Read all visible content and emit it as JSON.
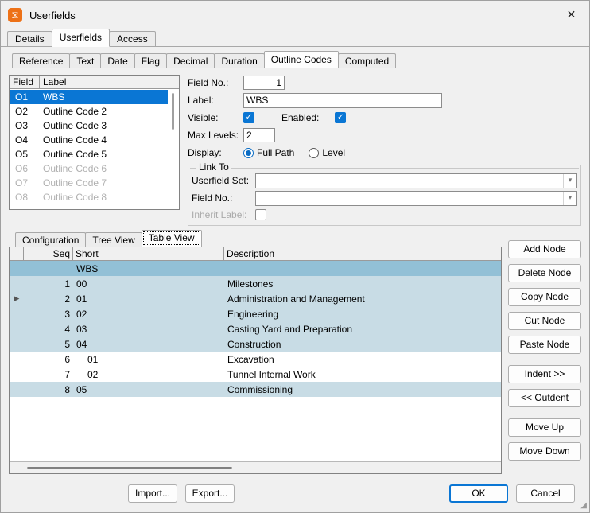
{
  "window": {
    "title": "Userfields",
    "icon": "app-spiral-icon",
    "close_label": "✕"
  },
  "outer_tabs": [
    {
      "label": "Details",
      "active": false
    },
    {
      "label": "Userfields",
      "active": true
    },
    {
      "label": "Access",
      "active": false
    }
  ],
  "inner_tabs": [
    {
      "label": "Reference",
      "active": false
    },
    {
      "label": "Text",
      "active": false
    },
    {
      "label": "Date",
      "active": false
    },
    {
      "label": "Flag",
      "active": false
    },
    {
      "label": "Decimal",
      "active": false
    },
    {
      "label": "Duration",
      "active": false
    },
    {
      "label": "Outline Codes",
      "active": true
    },
    {
      "label": "Computed",
      "active": false
    }
  ],
  "field_list": {
    "headers": {
      "field": "Field",
      "label": "Label"
    },
    "rows": [
      {
        "field": "O1",
        "label": "WBS",
        "selected": true,
        "disabled": false
      },
      {
        "field": "O2",
        "label": "Outline Code 2",
        "selected": false,
        "disabled": false
      },
      {
        "field": "O3",
        "label": "Outline Code 3",
        "selected": false,
        "disabled": false
      },
      {
        "field": "O4",
        "label": "Outline Code 4",
        "selected": false,
        "disabled": false
      },
      {
        "field": "O5",
        "label": "Outline Code 5",
        "selected": false,
        "disabled": false
      },
      {
        "field": "O6",
        "label": "Outline Code 6",
        "selected": false,
        "disabled": true
      },
      {
        "field": "O7",
        "label": "Outline Code 7",
        "selected": false,
        "disabled": true
      },
      {
        "field": "O8",
        "label": "Outline Code 8",
        "selected": false,
        "disabled": true
      }
    ]
  },
  "form": {
    "field_no_label": "Field No.:",
    "field_no_value": "1",
    "label_label": "Label:",
    "label_value": "WBS",
    "visible_label": "Visible:",
    "visible_checked": true,
    "enabled_label": "Enabled:",
    "enabled_checked": true,
    "max_levels_label": "Max Levels:",
    "max_levels_value": "2",
    "display_label": "Display:",
    "display_options": [
      {
        "label": "Full Path",
        "selected": true
      },
      {
        "label": "Level",
        "selected": false
      }
    ],
    "link_to": {
      "legend": "Link To",
      "userfield_set_label": "Userfield Set:",
      "userfield_set_value": "",
      "field_no_label": "Field No.:",
      "field_no_value": "",
      "inherit_label_label": "Inherit Label:",
      "inherit_label_checked": false,
      "inherit_label_disabled": true
    }
  },
  "view_tabs": [
    {
      "label": "Configuration",
      "active": false
    },
    {
      "label": "Tree View",
      "active": false
    },
    {
      "label": "Table View",
      "active": true
    }
  ],
  "grid": {
    "headers": {
      "mark": "",
      "seq": "Seq",
      "short": "Short",
      "description": "Description"
    },
    "rows": [
      {
        "mark": "",
        "seq": "",
        "short": "WBS",
        "description": "",
        "highlight": "strong",
        "indent": 0
      },
      {
        "mark": "",
        "seq": "1",
        "short": "00",
        "description": "Milestones",
        "highlight": "light",
        "indent": 0
      },
      {
        "mark": "▶",
        "seq": "2",
        "short": "01",
        "description": "Administration and Management",
        "highlight": "light",
        "indent": 0
      },
      {
        "mark": "",
        "seq": "3",
        "short": "02",
        "description": "Engineering",
        "highlight": "light",
        "indent": 0
      },
      {
        "mark": "",
        "seq": "4",
        "short": "03",
        "description": "Casting Yard and Preparation",
        "highlight": "light",
        "indent": 0
      },
      {
        "mark": "",
        "seq": "5",
        "short": "04",
        "description": "Construction",
        "highlight": "light",
        "indent": 0
      },
      {
        "mark": "",
        "seq": "6",
        "short": "01",
        "description": "Excavation",
        "highlight": "none",
        "indent": 1
      },
      {
        "mark": "",
        "seq": "7",
        "short": "02",
        "description": "Tunnel Internal Work",
        "highlight": "none",
        "indent": 1
      },
      {
        "mark": "",
        "seq": "8",
        "short": "05",
        "description": "Commissioning",
        "highlight": "light",
        "indent": 0
      }
    ]
  },
  "node_buttons": [
    {
      "label": "Add Node",
      "gap": false
    },
    {
      "label": "Delete Node",
      "gap": false
    },
    {
      "label": "Copy Node",
      "gap": false
    },
    {
      "label": "Cut Node",
      "gap": false
    },
    {
      "label": "Paste Node",
      "gap": false
    },
    {
      "label": "Indent >>",
      "gap": true
    },
    {
      "label": "<< Outdent",
      "gap": false
    },
    {
      "label": "Move Up",
      "gap": true
    },
    {
      "label": "Move Down",
      "gap": false
    }
  ],
  "footer": {
    "import_label": "Import...",
    "export_label": "Export...",
    "ok_label": "OK",
    "cancel_label": "Cancel"
  },
  "colors": {
    "accent": "#0a76d4",
    "selection": "#0a76d4",
    "row_highlight": "#c8dce5",
    "row_highlight_strong": "#92c0d6",
    "icon_orange": "#ed7117"
  }
}
